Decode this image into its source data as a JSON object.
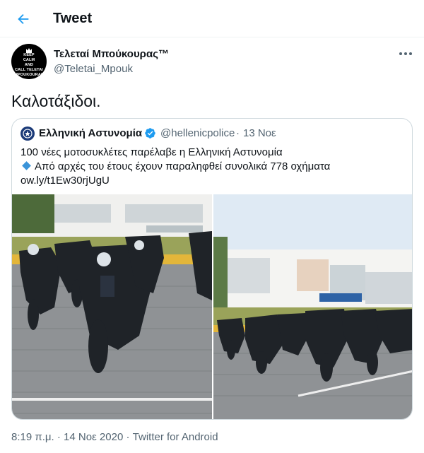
{
  "header": {
    "title": "Tweet"
  },
  "author": {
    "name": "Τελεταί Μπούκουρας™",
    "handle": "@Teletai_Mpouk",
    "avatar_text": [
      "KEEP",
      "CALM",
      "AND",
      "CALL TELETAI",
      "MPOUKOURAS"
    ]
  },
  "tweet": {
    "text": "Καλοτάξιδοι."
  },
  "quote": {
    "name": "Ελληνική Αστυνομία",
    "handle": "@hellenicpolice",
    "separator": "·",
    "date": "13 Νοε",
    "line1": "100 νέες μοτοσυκλέτες παρέλαβε η Ελληνική Αστυνομία",
    "line2": "Από αρχές του έτους έχουν παραληφθεί συνολικά 778 οχήματα",
    "line3": "ow.ly/t1Ew30rjUgU"
  },
  "footer": {
    "time": "8:19 π.μ.",
    "sep1": "·",
    "date": "14 Νοε 2020",
    "sep2": "·",
    "source": "Twitter for Android"
  },
  "colors": {
    "accent": "#1d9bf0",
    "secondary_text": "#536471",
    "border": "#cfd9de"
  },
  "icons": {
    "back": "arrow-left-icon",
    "more": "more-horizontal-icon",
    "verified": "verified-badge-icon"
  }
}
